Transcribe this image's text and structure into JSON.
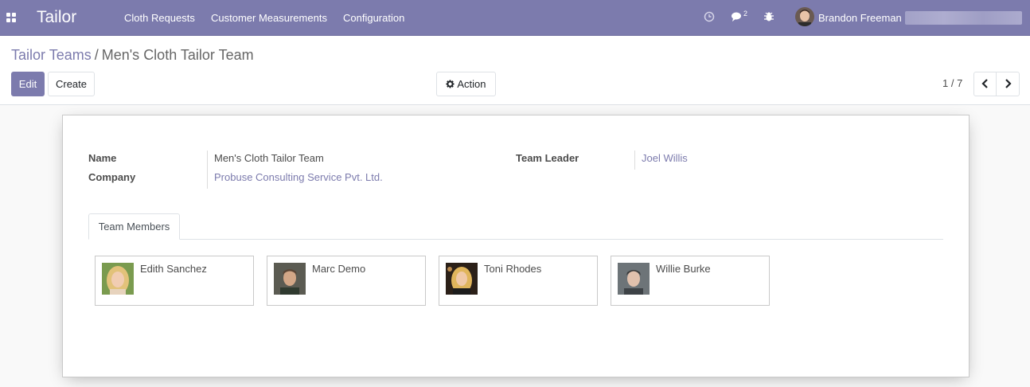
{
  "navbar": {
    "app_name": "Tailor",
    "menu": [
      "Cloth Requests",
      "Customer Measurements",
      "Configuration"
    ],
    "messages_count": "2",
    "user_name": "Brandon Freeman",
    "icons": [
      "apps-icon",
      "clock-icon",
      "chat-icon",
      "bug-icon"
    ],
    "accent": "#7c7bad"
  },
  "control_panel": {
    "breadcrumb_parent": "Tailor Teams",
    "breadcrumb_separator": "/",
    "breadcrumb_current": "Men's Cloth Tailor Team",
    "edit_label": "Edit",
    "create_label": "Create",
    "action_label": "Action",
    "pager_value": "1 / 7",
    "pager_prev_icon": "chevron-left-icon",
    "pager_next_icon": "chevron-right-icon"
  },
  "form": {
    "name_label": "Name",
    "name_value": "Men's Cloth Tailor Team",
    "company_label": "Company",
    "company_value": "Probuse Consulting Service Pvt. Ltd.",
    "leader_label": "Team Leader",
    "leader_value": "Joel Willis",
    "tab_label": "Team Members",
    "members": [
      {
        "name": "Edith Sanchez"
      },
      {
        "name": "Marc Demo"
      },
      {
        "name": "Toni Rhodes"
      },
      {
        "name": "Willie Burke"
      }
    ]
  }
}
